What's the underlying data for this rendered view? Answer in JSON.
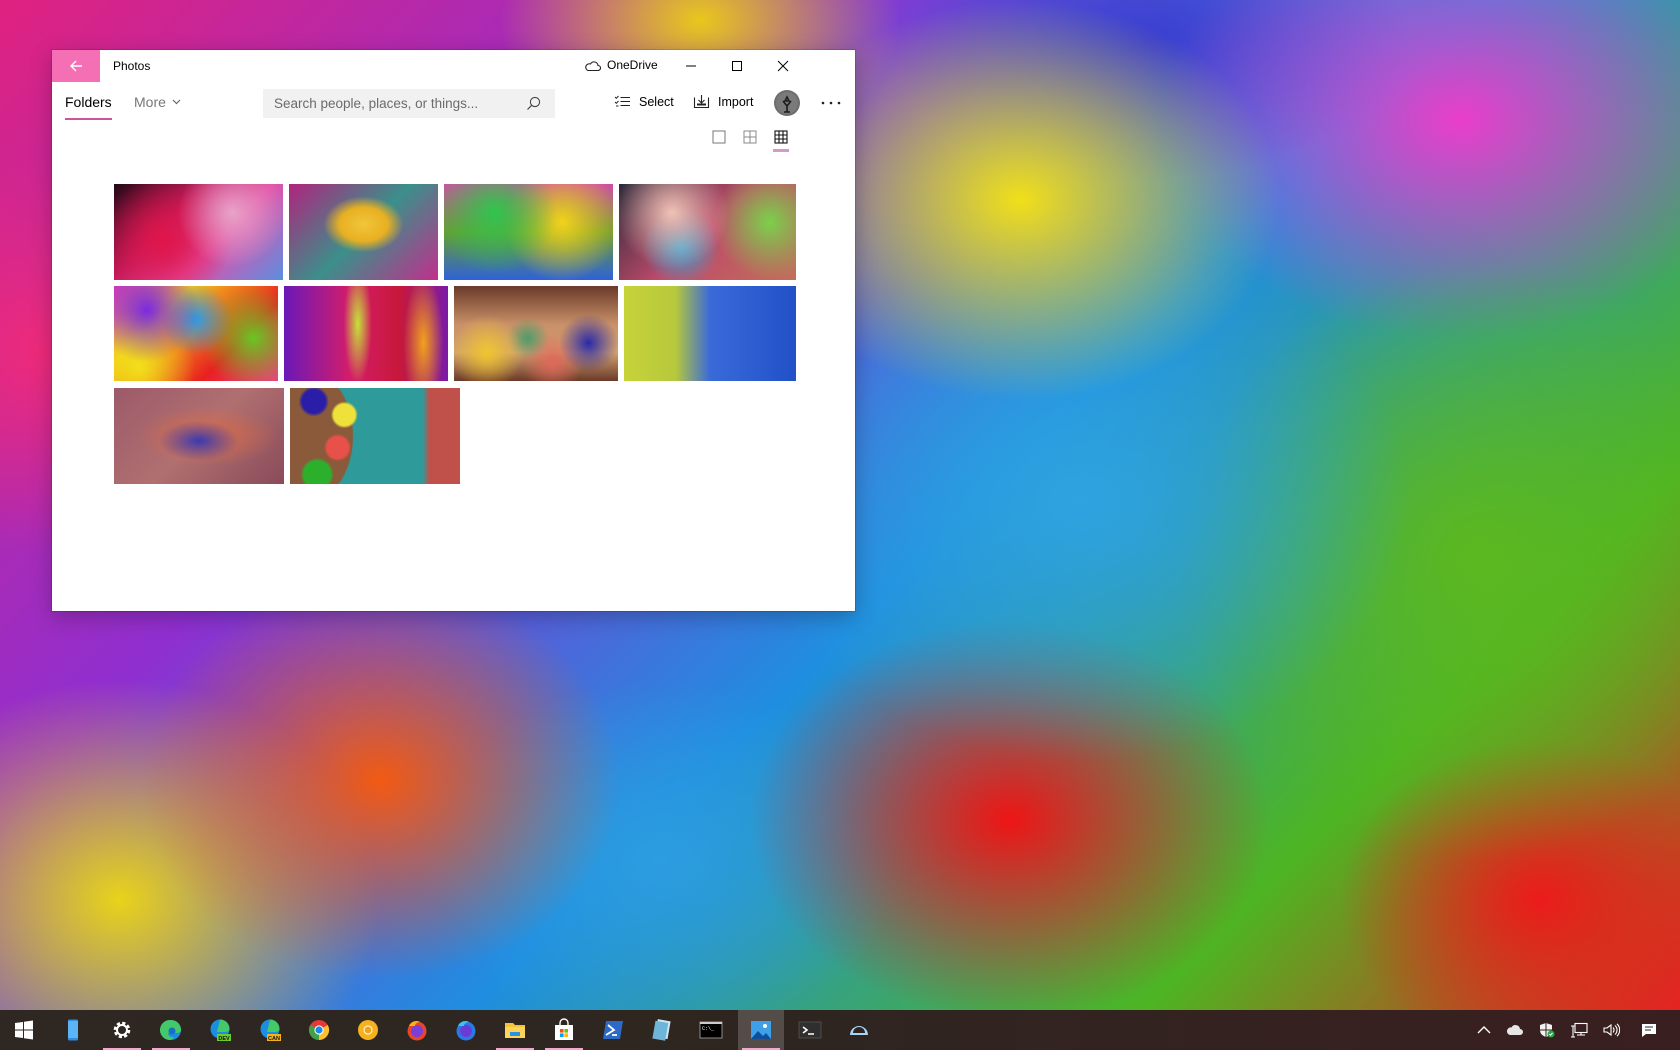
{
  "window": {
    "title": "Photos",
    "back_label": "Back",
    "onedrive_label": "OneDrive",
    "controls": {
      "minimize": "minimize",
      "maximize": "maximize",
      "close": "close"
    },
    "accent_color": "#f56fb5"
  },
  "nav": {
    "tabs": [
      {
        "label": "Folders",
        "selected": true
      },
      {
        "label": "More",
        "selected": false
      }
    ]
  },
  "search": {
    "placeholder": "Search people, places, or things...",
    "value": ""
  },
  "commands": {
    "select_label": "Select",
    "import_label": "Import"
  },
  "view_modes": [
    {
      "name": "large-tiles",
      "selected": false
    },
    {
      "name": "medium-tiles",
      "selected": false
    },
    {
      "name": "small-tiles",
      "selected": true
    }
  ],
  "photos": [
    {
      "row": 1,
      "subject": "hands raised in pink and red powder cloud"
    },
    {
      "row": 1,
      "subject": "yellow powder mound on purple and teal"
    },
    {
      "row": 1,
      "subject": "multicolor powder speckles"
    },
    {
      "row": 1,
      "subject": "colorful smoke explosion"
    },
    {
      "row": 2,
      "subject": "rainbow powder patches"
    },
    {
      "row": 2,
      "subject": "purple red yellow powder streaks"
    },
    {
      "row": 2,
      "subject": "powder cone piles at market"
    },
    {
      "row": 2,
      "subject": "yellow and blue powder"
    },
    {
      "row": 3,
      "subject": "blue and orange powder burst on mauve"
    },
    {
      "row": 3,
      "subject": "bowls of powder on teal rangoli"
    }
  ],
  "taskbar": {
    "items": [
      {
        "name": "start",
        "icon": "windows-logo-icon",
        "running": false,
        "active": false
      },
      {
        "name": "phone",
        "icon": "phone-icon",
        "running": false,
        "active": false
      },
      {
        "name": "settings",
        "icon": "gear-icon",
        "running": true,
        "active": false
      },
      {
        "name": "edge",
        "icon": "edge-icon",
        "running": true,
        "active": false
      },
      {
        "name": "edge-dev",
        "icon": "edge-dev-icon",
        "badge": "DEV",
        "running": false,
        "active": false
      },
      {
        "name": "edge-canary",
        "icon": "edge-canary-icon",
        "badge": "CAN",
        "running": false,
        "active": false
      },
      {
        "name": "chrome",
        "icon": "chrome-icon",
        "running": false,
        "active": false
      },
      {
        "name": "chrome-canary",
        "icon": "chrome-canary-icon",
        "running": false,
        "active": false
      },
      {
        "name": "firefox",
        "icon": "firefox-icon",
        "running": false,
        "active": false
      },
      {
        "name": "firefox-dev",
        "icon": "firefox-dev-icon",
        "running": false,
        "active": false
      },
      {
        "name": "file-explorer",
        "icon": "folder-icon",
        "running": true,
        "active": false
      },
      {
        "name": "store",
        "icon": "store-icon",
        "running": true,
        "active": false
      },
      {
        "name": "powershell",
        "icon": "powershell-icon",
        "running": false,
        "active": false
      },
      {
        "name": "notepad",
        "icon": "notepad-icon",
        "running": false,
        "active": false
      },
      {
        "name": "command-prompt",
        "icon": "cmd-icon",
        "running": false,
        "active": false
      },
      {
        "name": "photos",
        "icon": "photos-icon",
        "running": true,
        "active": true
      },
      {
        "name": "terminal",
        "icon": "terminal-icon",
        "running": false,
        "active": false
      },
      {
        "name": "remote",
        "icon": "half-circle-icon",
        "running": false,
        "active": false
      }
    ],
    "tray": [
      {
        "name": "show-hidden-icons",
        "icon": "chevron-up-icon"
      },
      {
        "name": "onedrive",
        "icon": "cloud-icon"
      },
      {
        "name": "windows-security",
        "icon": "shield-icon"
      },
      {
        "name": "network",
        "icon": "network-icon"
      },
      {
        "name": "volume",
        "icon": "speaker-icon"
      },
      {
        "name": "action-center",
        "icon": "notification-icon"
      }
    ]
  }
}
